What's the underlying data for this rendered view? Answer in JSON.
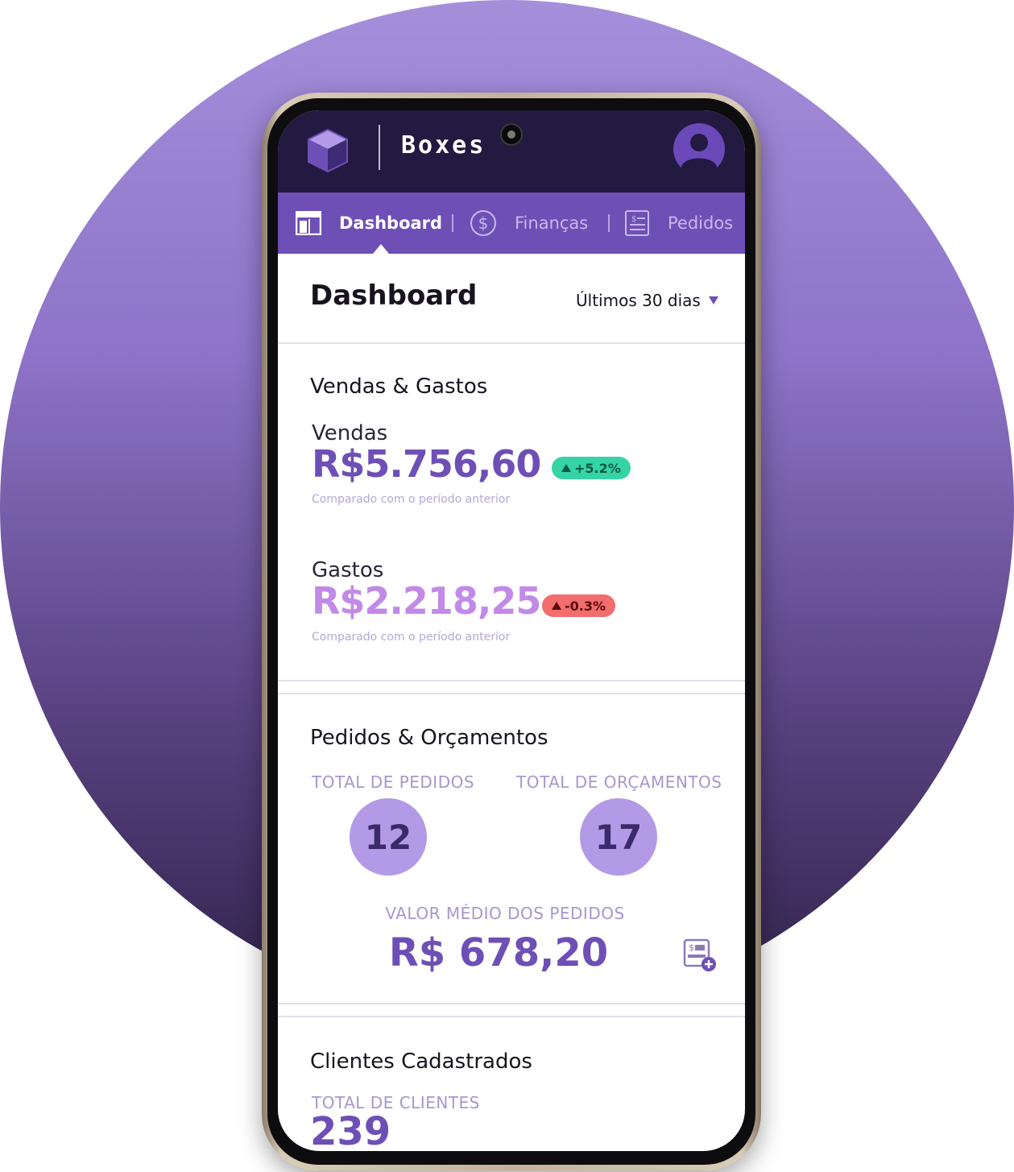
{
  "app": {
    "brand": "Boxes"
  },
  "tabs": [
    {
      "label": "Dashboard",
      "icon": "layout-icon",
      "active": true
    },
    {
      "label": "Finanças",
      "icon": "dollar-circle-icon",
      "active": false
    },
    {
      "label": "Pedidos",
      "icon": "document-icon",
      "active": false
    }
  ],
  "header": {
    "title": "Dashboard",
    "range": "Últimos 30 dias"
  },
  "sales_expenses": {
    "title": "Vendas & Gastos",
    "sales": {
      "label": "Vendas",
      "value": "R$5.756,60",
      "change": "+5.2%",
      "note": "Comparado com o período anterior",
      "color": "#6e4fb6",
      "badge_bg": "#35d3a5",
      "badge_fg": "#0a5a43"
    },
    "expenses": {
      "label": "Gastos",
      "value": "R$2.218,25",
      "change": "-0.3%",
      "note": "Comparado com o período anterior",
      "color": "#c18ae8",
      "badge_bg": "#f26d6d",
      "badge_fg": "#5a0a0a"
    }
  },
  "orders": {
    "title": "Pedidos & Orçamentos",
    "total_orders_label": "TOTAL DE PEDIDOS",
    "total_orders": "12",
    "total_quotes_label": "TOTAL DE ORÇAMENTOS",
    "total_quotes": "17",
    "avg_label": "VALOR MÉDIO DOS PEDIDOS",
    "avg_value": "R$ 678,20"
  },
  "clients": {
    "title": "Clientes Cadastrados",
    "label": "TOTAL DE  CLIENTES",
    "value": "239"
  }
}
